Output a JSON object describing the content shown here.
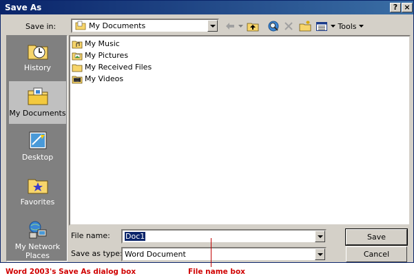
{
  "window": {
    "title": "Save As",
    "help_button": "?",
    "close_button": "×"
  },
  "toolbar": {
    "save_in_label": "Save in:",
    "save_in_value": "My Documents",
    "tools_label": "Tools"
  },
  "places": [
    {
      "label": "History"
    },
    {
      "label": "My Documents"
    },
    {
      "label": "Desktop"
    },
    {
      "label": "Favorites"
    },
    {
      "label": "My Network Places"
    }
  ],
  "files": [
    {
      "name": "My Music",
      "icon": "music-folder-icon"
    },
    {
      "name": "My Pictures",
      "icon": "pictures-folder-icon"
    },
    {
      "name": "My Received Files",
      "icon": "folder-icon"
    },
    {
      "name": "My Videos",
      "icon": "videos-folder-icon"
    }
  ],
  "form": {
    "file_name_label": "File name:",
    "file_name_value": "Doc1",
    "save_as_type_label": "Save as type:",
    "save_as_type_value": "Word Document"
  },
  "buttons": {
    "save": "Save",
    "cancel": "Cancel"
  },
  "captions": {
    "dialog": "Word 2003's Save As dialog box",
    "file_name_box": "File name box"
  },
  "colors": {
    "titlebar": "#0a246a",
    "selection": "#0a246a",
    "annotation": "#d00000"
  }
}
